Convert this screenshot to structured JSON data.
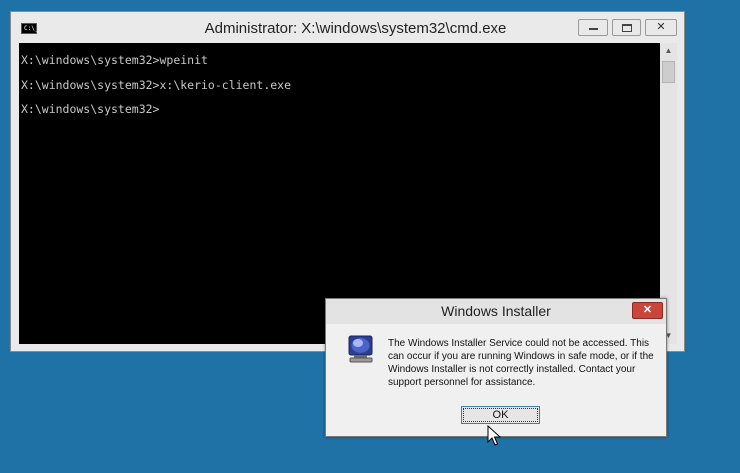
{
  "cmd_window": {
    "icon_text": "C:\\_",
    "title": "Administrator: X:\\windows\\system32\\cmd.exe",
    "console_lines": [
      "X:\\windows\\system32>wpeinit",
      "X:\\windows\\system32>x:\\kerio-client.exe",
      "X:\\windows\\system32>"
    ]
  },
  "dialog": {
    "title": "Windows Installer",
    "icon": "windows-installer-icon",
    "message": "The Windows Installer Service could not be accessed. This can occur if you are running Windows in safe mode, or if the Windows Installer is not correctly installed. Contact your support personnel for assistance.",
    "ok_label": "OK"
  },
  "colors": {
    "desktop": "#1e72a6",
    "console_bg": "#000000",
    "close_red": "#c9463d"
  }
}
